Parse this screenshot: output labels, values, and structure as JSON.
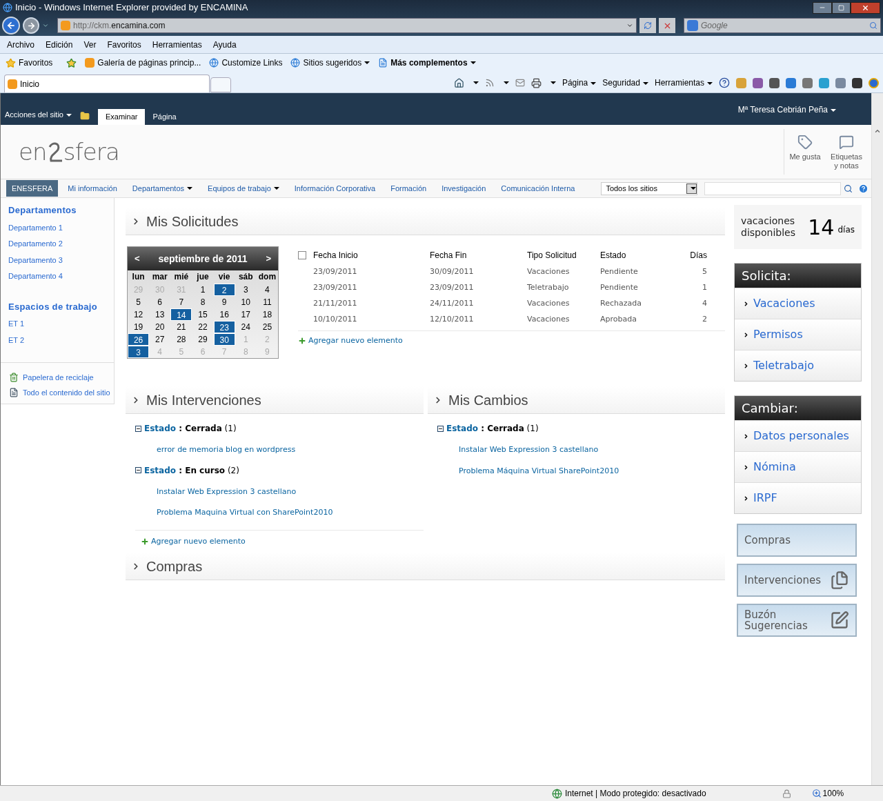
{
  "browser": {
    "title": "Inicio - Windows Internet Explorer provided by ENCAMINA",
    "address_prefix": "http://ckm.",
    "address_domain": "encamina.com",
    "search_placeholder": "Google",
    "menu": [
      "Archivo",
      "Edición",
      "Ver",
      "Favoritos",
      "Herramientas",
      "Ayuda"
    ],
    "favorites_label": "Favoritos",
    "favorites": [
      {
        "label": "Galería de páginas princip...",
        "kind": "sharepoint",
        "menu": false,
        "bold": false
      },
      {
        "label": "Customize Links",
        "kind": "ie",
        "menu": false,
        "bold": false
      },
      {
        "label": "Sitios sugeridos",
        "kind": "ie",
        "menu": true,
        "bold": false
      },
      {
        "label": "Más complementos",
        "kind": "page",
        "menu": true,
        "bold": true
      }
    ],
    "tab": "Inicio",
    "commands": [
      "Página",
      "Seguridad",
      "Herramientas"
    ]
  },
  "ribbon": {
    "site_actions": "Acciones del sitio",
    "tabs": [
      {
        "label": "Examinar",
        "selected": true
      },
      {
        "label": "Página",
        "selected": false
      }
    ],
    "user": "Mª Teresa Cebrián Peña"
  },
  "header": {
    "logo_left": "en",
    "logo_right": "sfera",
    "actions": [
      "Me gusta",
      "Etiquetas y notas"
    ]
  },
  "nav": {
    "items": [
      {
        "label": "ENESFERA",
        "selected": true,
        "menu": false
      },
      {
        "label": "Mi información",
        "selected": false,
        "menu": false
      },
      {
        "label": "Departamentos",
        "selected": false,
        "menu": true
      },
      {
        "label": "Equipos de trabajo",
        "selected": false,
        "menu": true
      },
      {
        "label": "Información Corporativa",
        "selected": false,
        "menu": false
      },
      {
        "label": "Formación",
        "selected": false,
        "menu": false
      },
      {
        "label": "Investigación",
        "selected": false,
        "menu": false
      },
      {
        "label": "Comunicación Interna",
        "selected": false,
        "menu": false
      }
    ],
    "scope": "Todos los sitios"
  },
  "left_nav": {
    "sections": [
      {
        "title": "Departamentos",
        "items": [
          "Departamento 1",
          "Departamento 2",
          "Departamento 3",
          "Departamento 4"
        ]
      },
      {
        "title": "Espacios de trabajo",
        "items": [
          "ET 1",
          "ET 2"
        ]
      }
    ],
    "footer": [
      {
        "label": "Papelera de reciclaje",
        "kind": "recycle"
      },
      {
        "label": "Todo el contenido del sitio",
        "kind": "content"
      }
    ]
  },
  "solicitudes": {
    "title": "Mis Solicitudes",
    "calendar": {
      "prev": "<",
      "next": ">",
      "month": "septiembre de 2011",
      "weekdays": [
        "lun",
        "mar",
        "mié",
        "jue",
        "vie",
        "sáb",
        "dom"
      ],
      "weeks": [
        [
          {
            "day": "29",
            "other": true,
            "marked": false
          },
          {
            "day": "30",
            "other": true,
            "marked": false
          },
          {
            "day": "31",
            "other": true,
            "marked": false
          },
          {
            "day": "1",
            "other": false,
            "marked": false
          },
          {
            "day": "2",
            "other": false,
            "marked": true
          },
          {
            "day": "3",
            "other": false,
            "marked": false
          },
          {
            "day": "4",
            "other": false,
            "marked": false
          }
        ],
        [
          {
            "day": "5",
            "other": false,
            "marked": false
          },
          {
            "day": "6",
            "other": false,
            "marked": false
          },
          {
            "day": "7",
            "other": false,
            "marked": false
          },
          {
            "day": "8",
            "other": false,
            "marked": false
          },
          {
            "day": "9",
            "other": false,
            "marked": false
          },
          {
            "day": "10",
            "other": false,
            "marked": false
          },
          {
            "day": "11",
            "other": false,
            "marked": false
          }
        ],
        [
          {
            "day": "12",
            "other": false,
            "marked": false
          },
          {
            "day": "13",
            "other": false,
            "marked": false
          },
          {
            "day": "14",
            "other": false,
            "marked": true
          },
          {
            "day": "15",
            "other": false,
            "marked": false
          },
          {
            "day": "16",
            "other": false,
            "marked": false
          },
          {
            "day": "17",
            "other": false,
            "marked": false
          },
          {
            "day": "18",
            "other": false,
            "marked": false
          }
        ],
        [
          {
            "day": "19",
            "other": false,
            "marked": false
          },
          {
            "day": "20",
            "other": false,
            "marked": false
          },
          {
            "day": "21",
            "other": false,
            "marked": false
          },
          {
            "day": "22",
            "other": false,
            "marked": false
          },
          {
            "day": "23",
            "other": false,
            "marked": true
          },
          {
            "day": "24",
            "other": false,
            "marked": false
          },
          {
            "day": "25",
            "other": false,
            "marked": false
          }
        ],
        [
          {
            "day": "26",
            "other": false,
            "marked": true
          },
          {
            "day": "27",
            "other": false,
            "marked": false
          },
          {
            "day": "28",
            "other": false,
            "marked": false
          },
          {
            "day": "29",
            "other": false,
            "marked": false
          },
          {
            "day": "30",
            "other": false,
            "marked": true
          },
          {
            "day": "1",
            "other": true,
            "marked": false
          },
          {
            "day": "2",
            "other": true,
            "marked": false
          }
        ],
        [
          {
            "day": "3",
            "other": true,
            "marked": true
          },
          {
            "day": "4",
            "other": true,
            "marked": false
          },
          {
            "day": "5",
            "other": true,
            "marked": false
          },
          {
            "day": "6",
            "other": true,
            "marked": false
          },
          {
            "day": "7",
            "other": true,
            "marked": false
          },
          {
            "day": "8",
            "other": true,
            "marked": false
          },
          {
            "day": "9",
            "other": true,
            "marked": false
          }
        ]
      ]
    },
    "select_all_checked": false,
    "columns": [
      "Fecha Inicio",
      "Fecha Fin",
      "Tipo Solicitud",
      "Estado",
      "Días"
    ],
    "rows": [
      [
        "23/09/2011",
        "30/09/2011",
        "Vacaciones",
        "Pendiente",
        "5"
      ],
      [
        "23/09/2011",
        "23/09/2011",
        "Teletrabajo",
        "Pendiente",
        "1"
      ],
      [
        "21/11/2011",
        "24/11/2011",
        "Vacaciones",
        "Rechazada",
        "4"
      ],
      [
        "10/10/2011",
        "12/10/2011",
        "Vacaciones",
        "Aprobada",
        "2"
      ]
    ],
    "add_link": "Agregar nuevo elemento"
  },
  "intervenciones": {
    "title": "Mis Intervenciones",
    "groups": [
      {
        "field": "Estado",
        "separator": ":",
        "value": "Cerrada",
        "count": "(1)",
        "expanded": true,
        "items": [
          "error de memoria blog en wordpress"
        ]
      },
      {
        "field": "Estado",
        "separator": ":",
        "value": "En curso",
        "count": "(2)",
        "expanded": true,
        "items": [
          "Instalar Web Expression 3 castellano",
          "Problema Maquina Virtual con SharePoint2010"
        ]
      }
    ],
    "add_link": "Agregar nuevo elemento"
  },
  "cambios": {
    "title": "Mis Cambios",
    "groups": [
      {
        "field": "Estado",
        "separator": ":",
        "value": "Cerrada",
        "count": "(1)",
        "expanded": true,
        "items": [
          "Instalar Web Expression 3 castellano",
          "Problema Máquina Virtual SharePoint2010"
        ]
      }
    ]
  },
  "compras": {
    "title": "Compras"
  },
  "right": {
    "vacation": {
      "label": "vacaciones disponibles",
      "number": "14",
      "unit": "días"
    },
    "panels": [
      {
        "title": "Solicita:",
        "items": [
          "Vacaciones",
          "Permisos",
          "Teletrabajo"
        ]
      },
      {
        "title": "Cambiar:",
        "items": [
          "Datos personales",
          "Nómina",
          "IRPF"
        ]
      }
    ],
    "buttons": [
      {
        "label": "Compras",
        "kind": "plain"
      },
      {
        "label": "Intervenciones",
        "kind": "documents"
      },
      {
        "label": "Buzón Sugerencias",
        "kind": "note"
      }
    ]
  },
  "status": {
    "zone": "Internet | Modo protegido: desactivado",
    "zoom": "100%"
  }
}
